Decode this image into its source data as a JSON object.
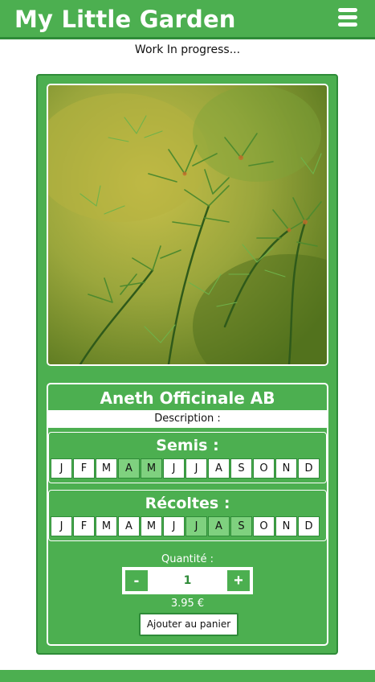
{
  "header": {
    "title": "My Little Garden",
    "menu_icon": "hamburger-menu-icon"
  },
  "notice": "Work In progress...",
  "product": {
    "image_description": "green feathery dill plant",
    "name": "Aneth Officinale AB",
    "description_label": "Description :",
    "semis": {
      "label": "Semis :",
      "months": [
        {
          "letter": "J",
          "active": false
        },
        {
          "letter": "F",
          "active": false
        },
        {
          "letter": "M",
          "active": false
        },
        {
          "letter": "A",
          "active": true
        },
        {
          "letter": "M",
          "active": true
        },
        {
          "letter": "J",
          "active": false
        },
        {
          "letter": "J",
          "active": false
        },
        {
          "letter": "A",
          "active": false
        },
        {
          "letter": "S",
          "active": false
        },
        {
          "letter": "O",
          "active": false
        },
        {
          "letter": "N",
          "active": false
        },
        {
          "letter": "D",
          "active": false
        }
      ]
    },
    "recoltes": {
      "label": "Récoltes :",
      "months": [
        {
          "letter": "J",
          "active": false
        },
        {
          "letter": "F",
          "active": false
        },
        {
          "letter": "M",
          "active": false
        },
        {
          "letter": "A",
          "active": false
        },
        {
          "letter": "M",
          "active": false
        },
        {
          "letter": "J",
          "active": false
        },
        {
          "letter": "J",
          "active": true
        },
        {
          "letter": "A",
          "active": true
        },
        {
          "letter": "S",
          "active": true
        },
        {
          "letter": "O",
          "active": false
        },
        {
          "letter": "N",
          "active": false
        },
        {
          "letter": "D",
          "active": false
        }
      ]
    },
    "quantity_label": "Quantité :",
    "quantity": "1",
    "minus_label": "-",
    "plus_label": "+",
    "price": "3.95 €",
    "add_to_cart_label": "Ajouter au panier"
  },
  "colors": {
    "primary": "#4caf50",
    "primary_dark": "#2e8b38",
    "month_active": "#7fd17f",
    "text_on_primary": "#ffffff"
  }
}
